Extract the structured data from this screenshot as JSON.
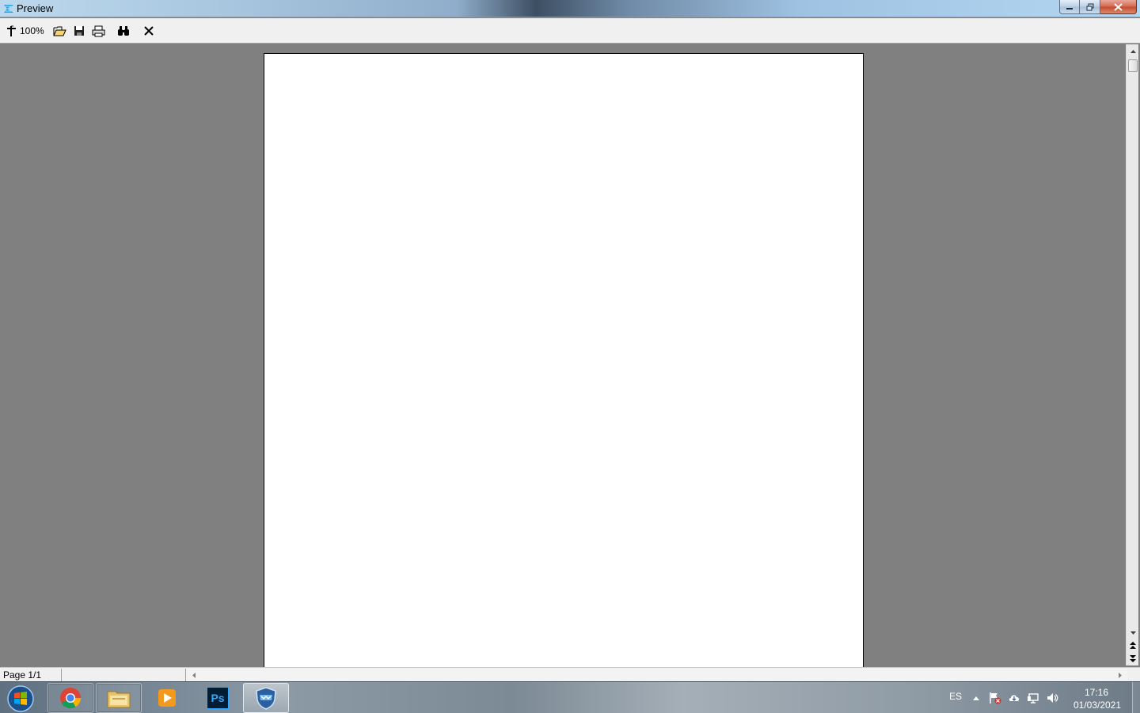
{
  "window": {
    "title": "Preview",
    "controls": {
      "minimize": "minimize-icon",
      "maximize": "restore-icon",
      "close": "close-icon"
    }
  },
  "toolbar": {
    "zoom_label": "100%",
    "items": [
      "zoom-icon",
      "open-folder-icon",
      "save-icon",
      "print-icon",
      "find-icon",
      "close-preview-icon"
    ]
  },
  "status": {
    "page_label": "Page 1/1"
  },
  "taskbar": {
    "apps": [
      "start-orb",
      "chrome",
      "file-explorer",
      "media-player",
      "photoshop",
      "security-shield"
    ],
    "photoshop_label": "Ps"
  },
  "tray": {
    "language": "ES",
    "time": "17:16",
    "date": "01/03/2021"
  },
  "colors": {
    "workspace": "#808080",
    "page": "#ffffff",
    "toolbar": "#f0f0f0"
  }
}
